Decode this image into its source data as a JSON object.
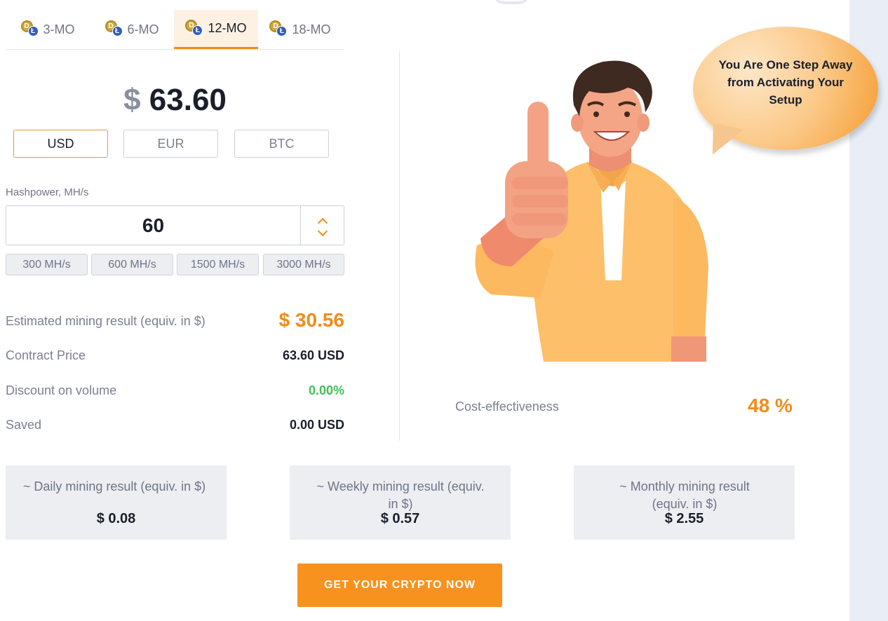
{
  "tabs": [
    {
      "label": "3-MO",
      "active": false
    },
    {
      "label": "6-MO",
      "active": false
    },
    {
      "label": "12-MO",
      "active": true
    },
    {
      "label": "18-MO",
      "active": false
    }
  ],
  "coin_glyphs": {
    "primary": "D",
    "secondary": "Ł"
  },
  "price": {
    "currency_symbol": "$",
    "value": "63.60"
  },
  "currencies": [
    {
      "label": "USD",
      "active": true
    },
    {
      "label": "EUR",
      "active": false
    },
    {
      "label": "BTC",
      "active": false
    }
  ],
  "hashpower": {
    "label": "Hashpower, MH/s",
    "value": "60",
    "presets": [
      "300 MH/s",
      "600 MH/s",
      "1500 MH/s",
      "3000 MH/s"
    ]
  },
  "summary": {
    "estimated_label": "Estimated mining result (equiv. in $)",
    "estimated_value": "$ 30.56",
    "contract_label": "Contract Price",
    "contract_value": "63.60 USD",
    "discount_label": "Discount on volume",
    "discount_value": "0.00%",
    "saved_label": "Saved",
    "saved_value": "0.00 USD"
  },
  "promo": {
    "bubble_text": "You Are One Step Away from Activating Your Setup",
    "cost_effectiveness_label": "Cost-effectiveness",
    "cost_effectiveness_value": "48 %"
  },
  "results": {
    "daily_label": "~ Daily mining result (equiv. in $)",
    "daily_value": "$ 0.08",
    "weekly_label": "~ Weekly mining result (equiv. in $)",
    "weekly_value": "$ 0.57",
    "monthly_label": "~ Monthly mining result (equiv. in $)",
    "monthly_value": "$ 2.55"
  },
  "cta": {
    "label": "GET YOUR CRYPTO NOW"
  },
  "colors": {
    "accent": "#f7921e",
    "positive": "#3fc15a",
    "text": "#1b1e2b",
    "muted": "#7b8091",
    "card_bg": "#eceef2"
  },
  "icons": [
    "dogecoin-icon",
    "litecoin-icon",
    "chevron-up-icon",
    "chevron-down-icon",
    "thumbs-up-man-illustration"
  ]
}
